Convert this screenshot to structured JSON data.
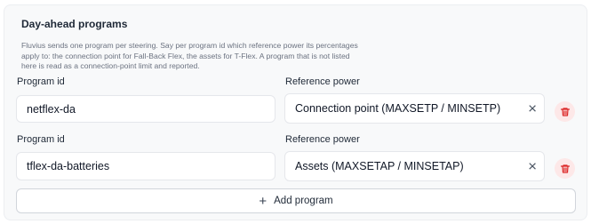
{
  "section": {
    "title": "Day-ahead programs",
    "description": "Fluvius sends one program per steering. Say per program id which reference power its percentages apply to: the connection point for Fall-Back Flex, the assets for T-Flex. A program that is not listed here is read as a connection-point limit and reported."
  },
  "programs": [
    {
      "program_id_label": "Program id",
      "program_id_value": "netflex-da",
      "reference_power_label": "Reference power",
      "reference_power_value": "Connection point (MAXSETP / MINSETP)",
      "clear_icon": "×",
      "delete_icon": "trash-icon"
    },
    {
      "program_id_label": "Program id",
      "program_id_value": "tflex-da-batteries",
      "reference_power_label": "Reference power",
      "reference_power_value": "Assets (MAXSETAP / MINSETAP)",
      "clear_icon": "×",
      "delete_icon": "trash-icon"
    }
  ],
  "add_button": {
    "icon": "+",
    "label": "Add program"
  },
  "colors": {
    "delete_icon": "#dc2626",
    "delete_bg": "#fde8e8"
  }
}
